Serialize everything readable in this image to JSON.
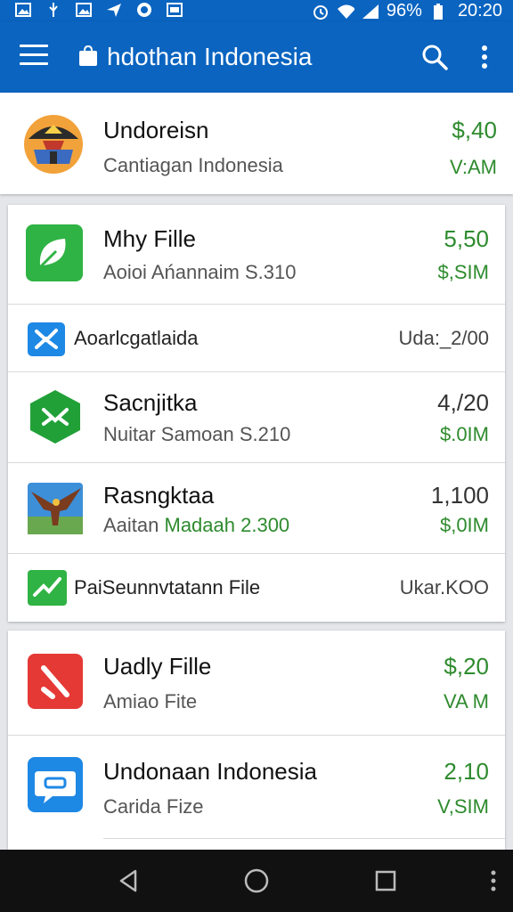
{
  "status_bar": {
    "battery": "96%",
    "time": "20:20",
    "icons": [
      "image-icon",
      "usb-icon",
      "image-icon",
      "send-icon",
      "whatsapp-icon",
      "image-icon",
      "alarm-icon",
      "wifi-icon",
      "signal-icon",
      "battery-icon"
    ]
  },
  "app_bar": {
    "title": "hdothan Indonesia",
    "icons": [
      "menu-icon",
      "shopping-bag-icon",
      "search-icon",
      "more-vert-icon"
    ]
  },
  "list": [
    {
      "title": "Undoreisn",
      "subtitle": "Cantiagan Indonesia",
      "price": "$,40",
      "meta": "V:AM",
      "icon": "indonesia-temple-icon"
    },
    {
      "title": "Mhy Fille",
      "subtitle": "Aoioi Ańannaim S.310",
      "price": "5,50",
      "meta": "$,SIM",
      "icon": "green-leaf-app-icon"
    },
    {
      "label": "Aoarlcgatlaida",
      "value": "Uda:_2/00",
      "icon": "blue-x-app-icon"
    },
    {
      "title": "Sacnjitka",
      "subtitle": "Nuitar Samoan S.210",
      "price": "4,/20",
      "meta": "$.0IM",
      "icon": "green-hexagon-app-icon"
    },
    {
      "title": "Rasngktaa",
      "subtitle_a": "Aaitan ",
      "subtitle_b": "Madaah 2.300",
      "price": "1,100",
      "meta": "$,0IM",
      "icon": "eagle-game-icon"
    },
    {
      "label": "PaiSeunnvtatann File",
      "value": "Ukar.KOO",
      "icon": "green-check-app-icon"
    },
    {
      "title": "Uadly Fille",
      "subtitle": "Amiao Fite",
      "price": "$,20",
      "meta": "VA M",
      "icon": "red-app-icon"
    },
    {
      "title": "Undonaan Indonesia",
      "subtitle": "Carida Fize",
      "price": "2,10",
      "meta": "V,SIM",
      "icon": "blue-chat-app-icon"
    }
  ],
  "colors": {
    "primary": "#0a64c0",
    "accent_green": "#2e8b2e",
    "background": "#e4e6ea"
  },
  "nav_bar": {
    "icons": [
      "back-icon",
      "home-icon",
      "recents-icon",
      "more-vert-icon"
    ]
  }
}
